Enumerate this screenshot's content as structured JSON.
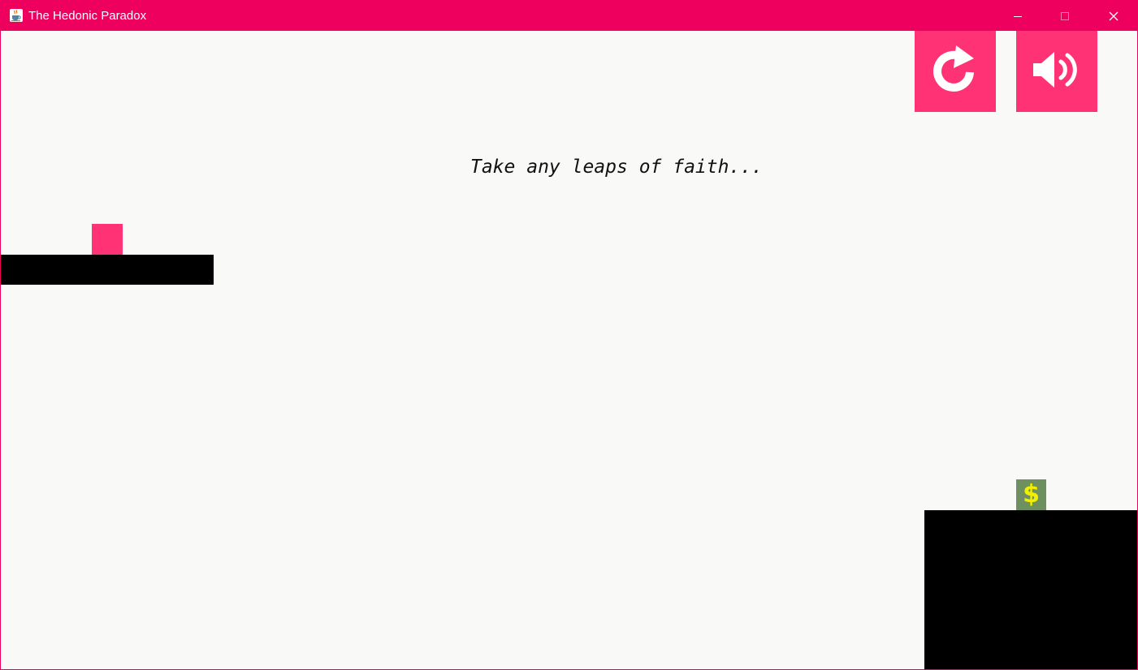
{
  "window": {
    "title": "The Hedonic Paradox",
    "title_bar_color": "#ee005f",
    "app_icon": "java-coffee-cup-icon",
    "controls": {
      "minimize_icon": "minimize-icon",
      "maximize_icon": "maximize-icon",
      "close_icon": "close-icon"
    }
  },
  "toolbar": {
    "restart_icon": "restart-icon",
    "sound_icon": "speaker-on-icon",
    "button_color": "#ff3275"
  },
  "game": {
    "hint_text": "Take any leaps of faith...",
    "background_color": "#f9f9f7",
    "player_color": "#ff3275",
    "platform_color": "#000000",
    "coin": {
      "symbol": "$",
      "background_color": "#6e9060",
      "symbol_color": "#f2f000"
    }
  }
}
